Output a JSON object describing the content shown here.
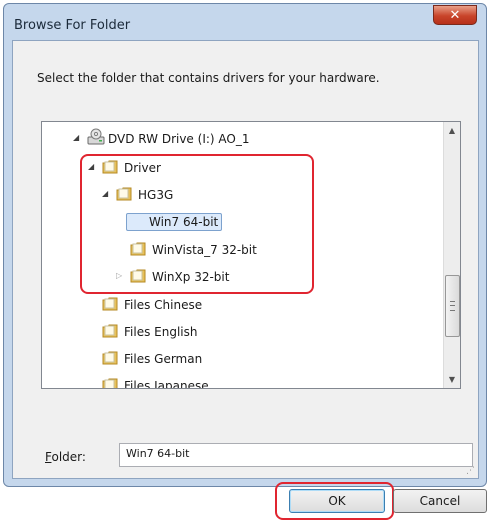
{
  "dialog": {
    "title": "Browse For Folder",
    "close_label": "✕",
    "instruction": "Select the folder that contains drivers for your hardware."
  },
  "tree": {
    "items": [
      {
        "label": "DVD RW Drive (I:) AO_1",
        "type": "drive",
        "expander": "expanded"
      },
      {
        "label": "Driver",
        "type": "folder",
        "expander": "expanded"
      },
      {
        "label": "HG3G",
        "type": "folder",
        "expander": "expanded"
      },
      {
        "label": "Win7 64-bit",
        "type": "folder",
        "expander": "none",
        "selected": true
      },
      {
        "label": "WinVista_7 32-bit",
        "type": "folder",
        "expander": "none"
      },
      {
        "label": "WinXp 32-bit",
        "type": "folder",
        "expander": "collapsed"
      },
      {
        "label": "Files Chinese",
        "type": "folder",
        "expander": "none"
      },
      {
        "label": "Files English",
        "type": "folder",
        "expander": "none"
      },
      {
        "label": "Files German",
        "type": "folder",
        "expander": "none"
      },
      {
        "label": "Files Japanese",
        "type": "folder",
        "expander": "none"
      }
    ]
  },
  "folder_field": {
    "label_mnemonic": "F",
    "label_rest": "older:",
    "value": "Win7 64-bit"
  },
  "buttons": {
    "ok": "OK",
    "cancel": "Cancel"
  },
  "colors": {
    "highlight": "#e02530",
    "selection": "#dceafb",
    "folder": "#e8c15a"
  }
}
